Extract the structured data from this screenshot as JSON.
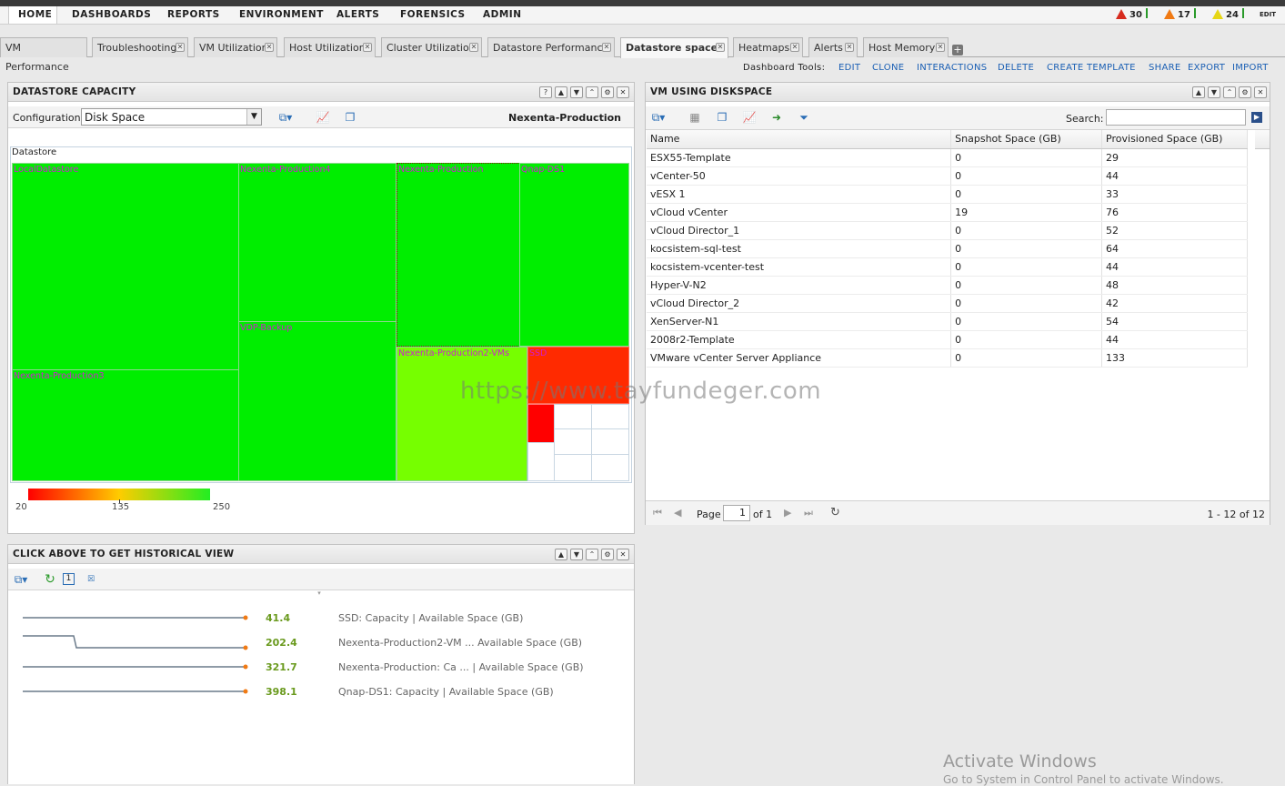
{
  "nav": {
    "items": [
      "HOME",
      "DASHBOARDS",
      "REPORTS",
      "ENVIRONMENT",
      "ALERTS",
      "FORENSICS",
      "ADMIN"
    ],
    "alerts": {
      "critical": "30",
      "major": "17",
      "minor": "24",
      "edit": "EDIT"
    }
  },
  "tabs": [
    "VM Performance",
    "Troubleshooting",
    "VM Utilization",
    "Host Utilization",
    "Cluster Utilization",
    "Datastore Performance",
    "Datastore space",
    "Heatmaps",
    "Alerts",
    "Host Memory"
  ],
  "tools": {
    "label": "Dashboard Tools:",
    "links": [
      "EDIT",
      "CLONE",
      "INTERACTIONS",
      "DELETE",
      "CREATE TEMPLATE",
      "SHARE",
      "EXPORT",
      "IMPORT"
    ]
  },
  "capacity": {
    "title": "DATASTORE CAPACITY",
    "config_label": "Configuration:",
    "config_value": "Disk Space",
    "selected": "Nexenta-Production",
    "tree_header": "Datastore",
    "cells": [
      "LocalDatastore",
      "Nexenta-Production4",
      "Nexenta-Production",
      "Qnap-DS1",
      "VDP-Backup",
      "Nexenta-Production3",
      "Nexenta-Production2-VMs",
      "SSD"
    ],
    "legend": {
      "min": "20",
      "mid": "135",
      "max": "250",
      "colors": [
        "#ff0000",
        "#ffcc00",
        "#22ee22"
      ]
    }
  },
  "vmdisk": {
    "title": "VM USING DISKSPACE",
    "search_label": "Search:",
    "columns": [
      "Name",
      "Snapshot Space (GB)",
      "Provisioned Space (GB)"
    ],
    "rows": [
      [
        "ESX55-Template",
        "0",
        "29"
      ],
      [
        "vCenter-50",
        "0",
        "44"
      ],
      [
        "vESX 1",
        "0",
        "33"
      ],
      [
        "vCloud vCenter",
        "19",
        "76"
      ],
      [
        "vCloud Director_1",
        "0",
        "52"
      ],
      [
        "kocsistem-sql-test",
        "0",
        "64"
      ],
      [
        "kocsistem-vcenter-test",
        "0",
        "44"
      ],
      [
        "Hyper-V-N2",
        "0",
        "48"
      ],
      [
        "vCloud Director_2",
        "0",
        "42"
      ],
      [
        "XenServer-N1",
        "0",
        "54"
      ],
      [
        "2008r2-Template",
        "0",
        "44"
      ],
      [
        "VMware vCenter Server Appliance",
        "0",
        "133"
      ]
    ],
    "pager": {
      "page_label": "Page",
      "page": "1",
      "of": "of 1",
      "summary": "1 - 12 of 12"
    }
  },
  "history": {
    "title": "CLICK ABOVE TO GET HISTORICAL VIEW",
    "items": [
      {
        "value": "41.4",
        "label": "SSD: Capacity | Available Space (GB)"
      },
      {
        "value": "202.4",
        "label": "Nexenta-Production2-VM ...  Available Space (GB)"
      },
      {
        "value": "321.7",
        "label": "Nexenta-Production: Ca ... | Available Space (GB)"
      },
      {
        "value": "398.1",
        "label": "Qnap-DS1: Capacity | Available Space (GB)"
      }
    ]
  },
  "watermark": "https://www.tayfundeger.com",
  "activate": {
    "title": "Activate Windows",
    "sub": "Go to System in Control Panel to activate Windows."
  }
}
